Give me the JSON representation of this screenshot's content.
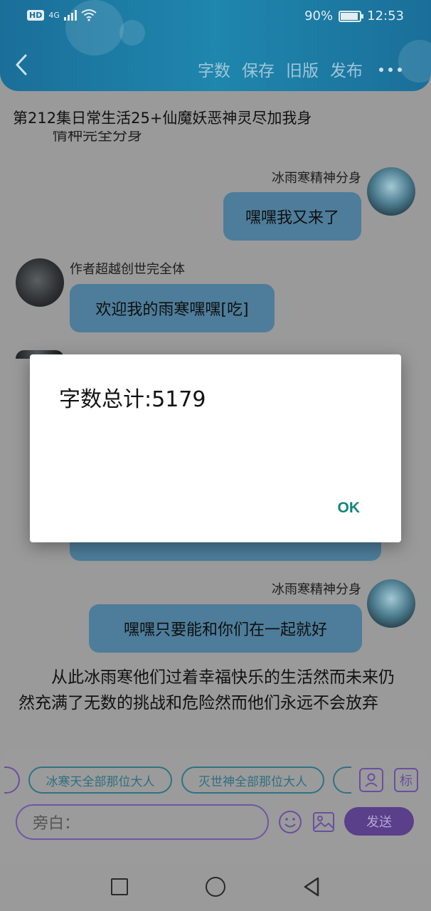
{
  "status_bar": {
    "left_badge": "HD",
    "network": "4G",
    "battery_percent_text": "90%",
    "battery_level": 0.9,
    "time": "12:53"
  },
  "toolbar": {
    "back_icon": "chevron-left-icon",
    "word_count_label": "字数",
    "save_label": "保存",
    "old_version_label": "旧版",
    "publish_label": "发布",
    "more_icon": "more-horizontal-icon"
  },
  "document": {
    "title": "第212集日常生活25+仙魔妖恶神灵尽加我身",
    "clipped_line": "情种完全分身"
  },
  "messages": [
    {
      "name": "冰雨寒精神分身",
      "text": "嘿嘿我又来了",
      "side": "right"
    },
    {
      "name": "作者超越创世完全体",
      "text": "欢迎我的雨寒嘿嘿[吃]",
      "side": "left"
    },
    {
      "name": "冰雨寒精神分身",
      "text": "嘿嘿只要能和你们在一起就好",
      "side": "right"
    }
  ],
  "narration": "从此冰雨寒他们过着幸福快乐的生活然而未来仍然充满了无数的挑战和危险然而他们永远不会放弃",
  "input_area": {
    "chips": [
      "冰寒天全部那位大人",
      "灭世神全部那位大人"
    ],
    "person_icon": "person-icon",
    "tag_icon_label": "标",
    "input_placeholder": "旁白：",
    "emoji_icon": "smile-icon",
    "image_icon": "image-icon",
    "send_label": "发送"
  },
  "dialog": {
    "title": "字数总计:5179",
    "ok_label": "OK"
  },
  "navbar": {
    "recents_icon": "square-icon",
    "home_icon": "circle-icon",
    "back_icon": "triangle-back-icon"
  },
  "colors": {
    "header": "#1a6f99",
    "bubble": "#4d7d9a",
    "accent_purple": "#6a4fa0",
    "ok_teal": "#12857a",
    "dim_background": "#9a9a9a"
  }
}
